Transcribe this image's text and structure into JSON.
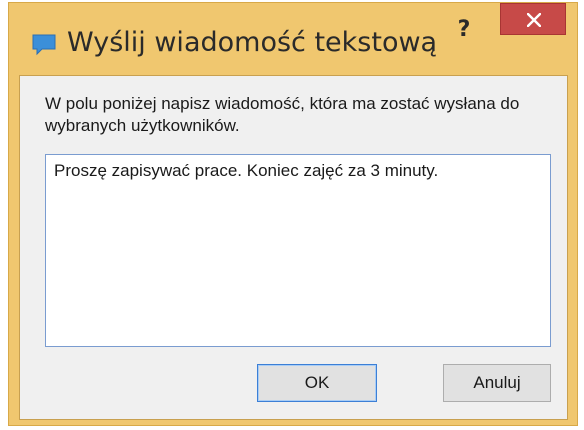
{
  "dialog": {
    "title": "Wyślij wiadomość tekstową",
    "help_label": "?",
    "app_icon": "speech-bubble-icon",
    "close_icon": "close-icon"
  },
  "content": {
    "instructions": "W polu poniżej napisz wiadomość, która ma zostać wysłana do wybranych użytkowników.",
    "message_value": "Proszę zapisywać prace. Koniec zajęć za 3 minuty."
  },
  "buttons": {
    "ok_label": "OK",
    "cancel_label": "Anuluj"
  },
  "colors": {
    "frame": "#f0c76f",
    "close_button": "#c74a48",
    "client_background": "#f0f0f0",
    "focus_border": "#3c7fd6"
  }
}
